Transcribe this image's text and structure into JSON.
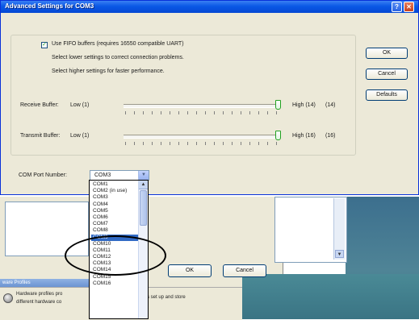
{
  "dialog": {
    "title": "Advanced Settings for COM3",
    "help_glyph": "?",
    "close_glyph": "✕",
    "fifo_checkbox": {
      "label": "Use FIFO buffers (requires 16550 compatible UART)",
      "checked": true,
      "check_glyph": "✓"
    },
    "info_line1": "Select lower settings to correct connection problems.",
    "info_line2": "Select higher settings for faster performance.",
    "receive": {
      "label": "Receive Buffer:",
      "low": "Low (1)",
      "high": "High (14)",
      "value": "(14)",
      "level": 1.0
    },
    "transmit": {
      "label": "Transmit Buffer:",
      "low": "Low (1)",
      "high": "High (16)",
      "value": "(16)",
      "level": 1.0
    },
    "buttons": {
      "ok": "OK",
      "cancel": "Cancel",
      "defaults": "Defaults"
    },
    "port": {
      "label": "COM Port Number:",
      "value": "COM3",
      "arrow_glyph": "▼"
    }
  },
  "dropdown": {
    "items": [
      "COM1",
      "COM2 (in use)",
      "COM3",
      "COM4",
      "COM5",
      "COM6",
      "COM7",
      "COM8",
      "COM9",
      "COM10",
      "COM11",
      "COM12",
      "COM13",
      "COM14",
      "COM15",
      "COM16"
    ],
    "selected": "COM9",
    "up_glyph": "▲"
  },
  "background": {
    "ok_label": "OK",
    "cancel_label": "Cancel",
    "scroll_glyph": "▼",
    "hw_title": "ware Profiles",
    "hw_line1": "Hardware profiles pro",
    "hw_line2": "different hardware co",
    "hw_line3": "s set up and store"
  },
  "colors": {
    "titlebar": "#0a58e6",
    "selection": "#316ac5",
    "thumb_border": "#21a121",
    "dialog_bg": "#ece9d8"
  }
}
